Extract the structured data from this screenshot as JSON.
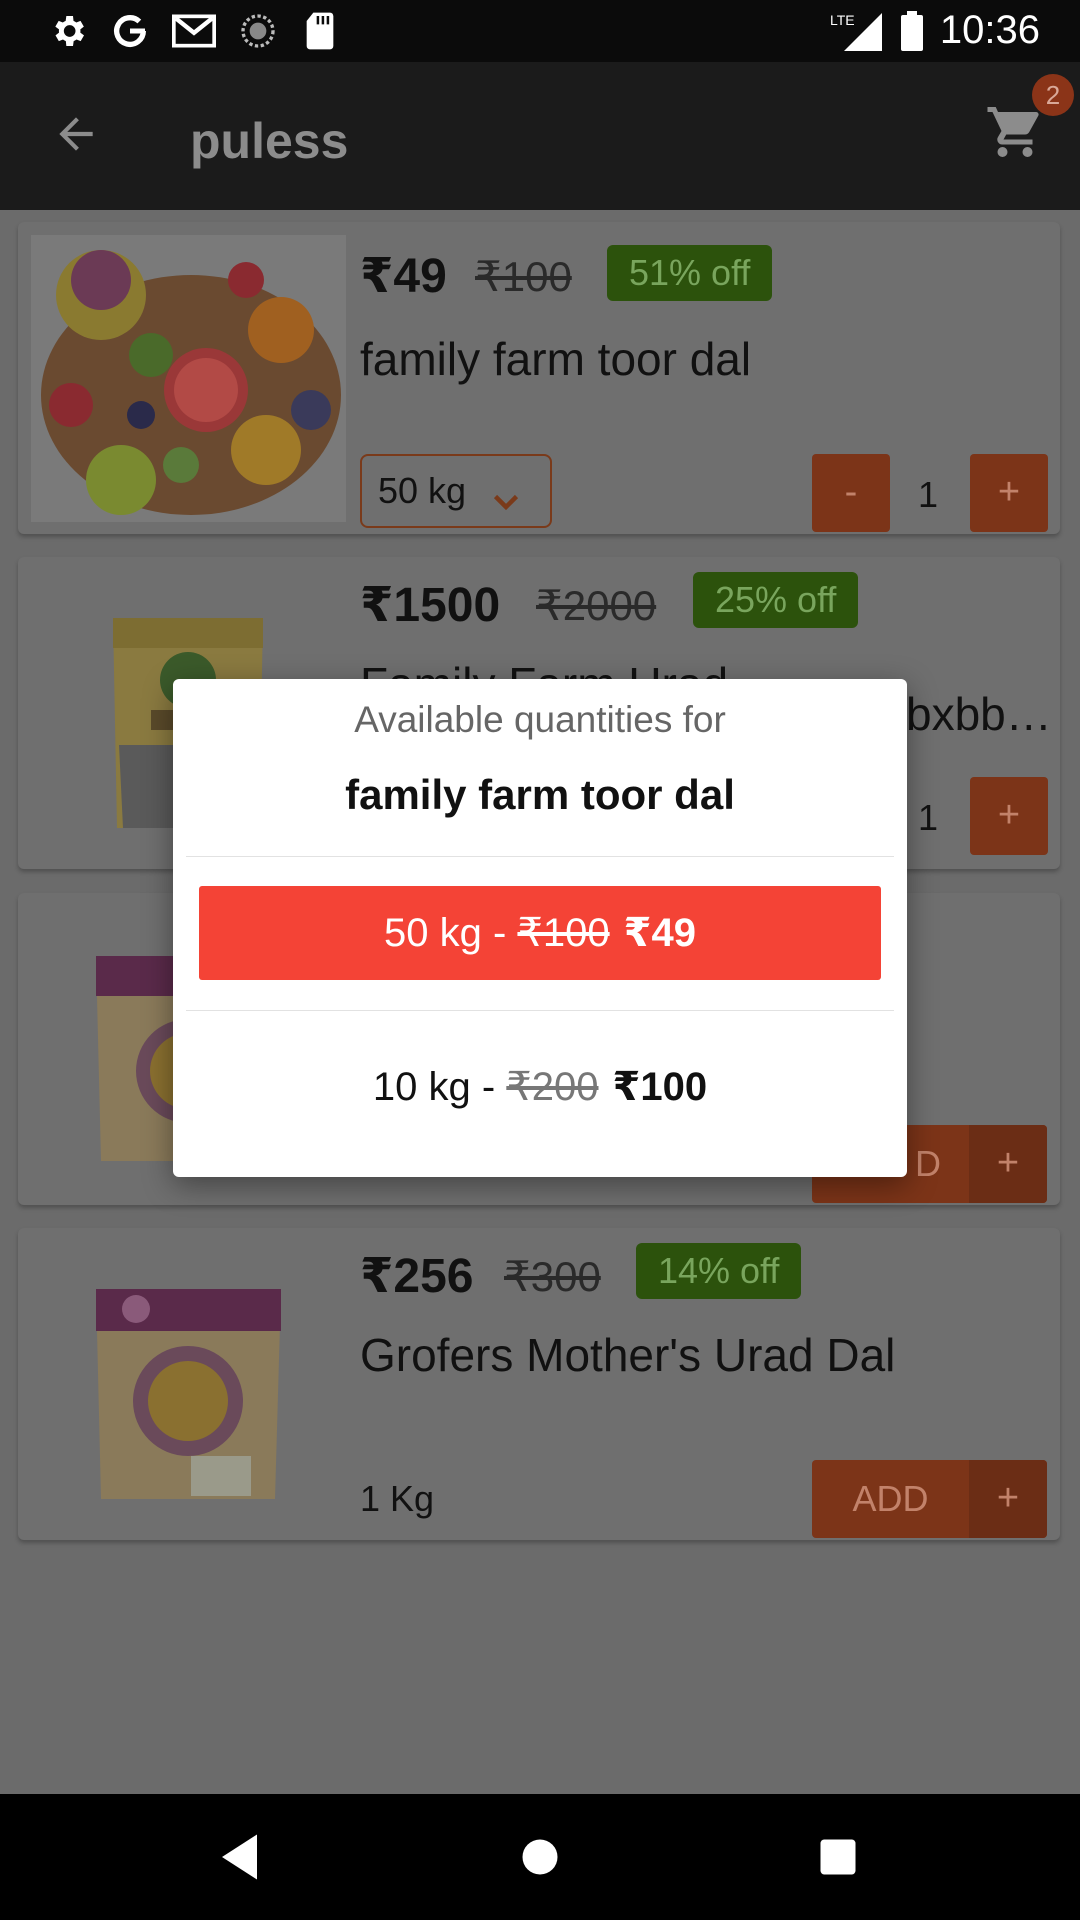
{
  "status_bar": {
    "time": "10:36",
    "network": "LTE",
    "icons": [
      "settings-icon",
      "google-icon",
      "gmail-icon",
      "sync-icon",
      "sd-card-icon"
    ]
  },
  "app_bar": {
    "title": "puless",
    "cart_count": "2"
  },
  "products": [
    {
      "price": "₹49",
      "mrp": "₹100",
      "discount": "51% off",
      "name": "family farm toor dal",
      "unit": "50 kg",
      "quantity": "1",
      "minus_label": "-",
      "plus_label": "+"
    },
    {
      "price": "₹1500",
      "mrp": "₹2000",
      "discount": "25% off",
      "name_visible": "Family Farm Urad",
      "name_tail": "bxbb…",
      "quantity": "1",
      "plus_label": "+"
    },
    {
      "add_partial": "D",
      "plus_label": "+"
    },
    {
      "price": "₹256",
      "mrp": "₹300",
      "discount": "14% off",
      "name": "Grofers Mother's Urad Dal",
      "unit": "1 Kg",
      "add_label": "ADD",
      "plus_label": "+"
    }
  ],
  "dialog": {
    "subtitle": "Available quantities for",
    "product_name": "family farm toor dal",
    "options": [
      {
        "label": "50 kg - ",
        "mrp": "₹100",
        "price": "₹49",
        "selected": true
      },
      {
        "label": "10 kg - ",
        "mrp": "₹200",
        "price": "₹100",
        "selected": false
      }
    ]
  },
  "colors": {
    "accent": "#f44336",
    "add_button": "#e0622d",
    "discount_badge": "#5aa61a",
    "app_bar": "#212121"
  }
}
